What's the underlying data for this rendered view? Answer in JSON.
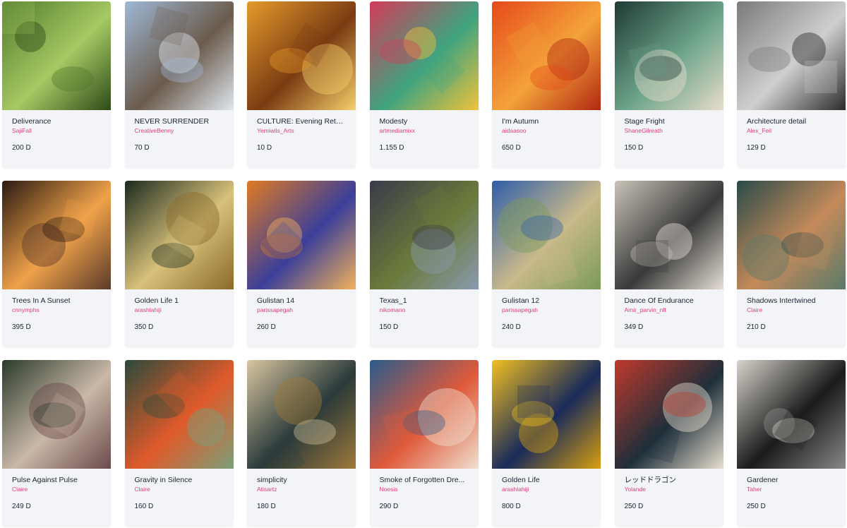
{
  "artworks": [
    {
      "title": "Deliverance",
      "artist": "SajiFall",
      "price": "200 D"
    },
    {
      "title": "NEVER SURRENDER",
      "artist": "CreativeBenny",
      "price": "70 D"
    },
    {
      "title": "CULTURE: Evening Return",
      "artist": "Yemiwils_Arts",
      "price": "10 D"
    },
    {
      "title": "Modesty",
      "artist": "artmediamixx",
      "price": "1.155 D"
    },
    {
      "title": "I'm Autumn",
      "artist": "aidaasoo",
      "price": "650 D"
    },
    {
      "title": "Stage Fright",
      "artist": "ShaneGilreath",
      "price": "150 D"
    },
    {
      "title": "Architecture detail",
      "artist": "Alex_Feil",
      "price": "129 D"
    },
    {
      "title": "Trees In A Sunset",
      "artist": "cnnymphs",
      "price": "395 D"
    },
    {
      "title": "Golden Life 1",
      "artist": "arashlahiji",
      "price": "350 D"
    },
    {
      "title": "Gulistan 14",
      "artist": "parissapegah",
      "price": "260 D"
    },
    {
      "title": "Texas_1",
      "artist": "nikomano",
      "price": "150 D"
    },
    {
      "title": "Gulistan 12",
      "artist": "parissapegah",
      "price": "240 D"
    },
    {
      "title": "Dance Of Endurance",
      "artist": "Amir_parvin_nft",
      "price": "349 D"
    },
    {
      "title": "Shadows Intertwined",
      "artist": "Claire",
      "price": "210 D"
    },
    {
      "title": "Pulse Against Pulse",
      "artist": "Claire",
      "price": "249 D"
    },
    {
      "title": "Gravity in Silence",
      "artist": "Claire",
      "price": "160 D"
    },
    {
      "title": "simplicity",
      "artist": "Atisartz",
      "price": "180 D"
    },
    {
      "title": "Smoke of Forgotten Dre...",
      "artist": "Noesis",
      "price": "290 D"
    },
    {
      "title": "Golden Life",
      "artist": "arashlahiji",
      "price": "800 D"
    },
    {
      "title": "レッドドラゴン",
      "artist": "Yolande",
      "price": "250 D"
    },
    {
      "title": "Gardener",
      "artist": "Taher",
      "price": "250 D"
    }
  ],
  "thumb_images": [
    {
      "img": "bird-in-forest-image",
      "colors": [
        "#4d7a2a",
        "#a7c964",
        "#2e4a18"
      ]
    },
    {
      "img": "tower-climber-image",
      "colors": [
        "#9fb8d6",
        "#6b5b4c",
        "#dfe7ef"
      ]
    },
    {
      "img": "savanna-women-image",
      "colors": [
        "#e59a2b",
        "#7a3b12",
        "#f5d06b"
      ]
    },
    {
      "img": "modesty-collage-image",
      "colors": [
        "#d43b5a",
        "#3fa37f",
        "#f0c23a"
      ]
    },
    {
      "img": "autumn-face-image",
      "colors": [
        "#e64a1a",
        "#f3a23a",
        "#b22812"
      ]
    },
    {
      "img": "stage-fright-image",
      "colors": [
        "#1f3a35",
        "#6da58a",
        "#e8dccb"
      ]
    },
    {
      "img": "architecture-bw-image",
      "colors": [
        "#7a7a7a",
        "#cfcfcf",
        "#2b2b2b"
      ]
    },
    {
      "img": "sunset-trees-image",
      "colors": [
        "#2a1a12",
        "#f0a24a",
        "#5a3a2a"
      ]
    },
    {
      "img": "golden-calligraphy-image",
      "colors": [
        "#1a2a1e",
        "#d8c17a",
        "#8a6a2a"
      ]
    },
    {
      "img": "gulistan-orange-image",
      "colors": [
        "#e07a22",
        "#3b3f9a",
        "#f2b25a"
      ]
    },
    {
      "img": "texas-map-image",
      "colors": [
        "#3a3a4a",
        "#6a7a3a",
        "#8a9ab0"
      ]
    },
    {
      "img": "gulistan-blue-image",
      "colors": [
        "#2f5ea8",
        "#c9b98a",
        "#7a9a5a"
      ]
    },
    {
      "img": "dance-endurance-image",
      "colors": [
        "#c9c3b8",
        "#3a3a3a",
        "#e6e0d6"
      ]
    },
    {
      "img": "shadows-portrait-image",
      "colors": [
        "#2a4a4a",
        "#c48a5a",
        "#5a7a6a"
      ]
    },
    {
      "img": "pulse-portrait-image",
      "colors": [
        "#2a3a2a",
        "#c9b8a8",
        "#6a4a4a"
      ]
    },
    {
      "img": "gravity-silence-image",
      "colors": [
        "#2a4a3a",
        "#e05a2a",
        "#7aa07a"
      ]
    },
    {
      "img": "simplicity-flowers-image",
      "colors": [
        "#d8c6a0",
        "#2a3a3a",
        "#a07a3a"
      ]
    },
    {
      "img": "smoke-dream-image",
      "colors": [
        "#2a5a8a",
        "#e05a3a",
        "#f0e0d0"
      ]
    },
    {
      "img": "golden-life-image",
      "colors": [
        "#f0c020",
        "#1a2a5a",
        "#d8a010"
      ]
    },
    {
      "img": "red-dragon-image",
      "colors": [
        "#c0392b",
        "#1f2f3a",
        "#e8e0d0"
      ]
    },
    {
      "img": "gardener-silhouette-image",
      "colors": [
        "#d8d4cc",
        "#1a1a1a",
        "#8a8a8a"
      ]
    }
  ]
}
